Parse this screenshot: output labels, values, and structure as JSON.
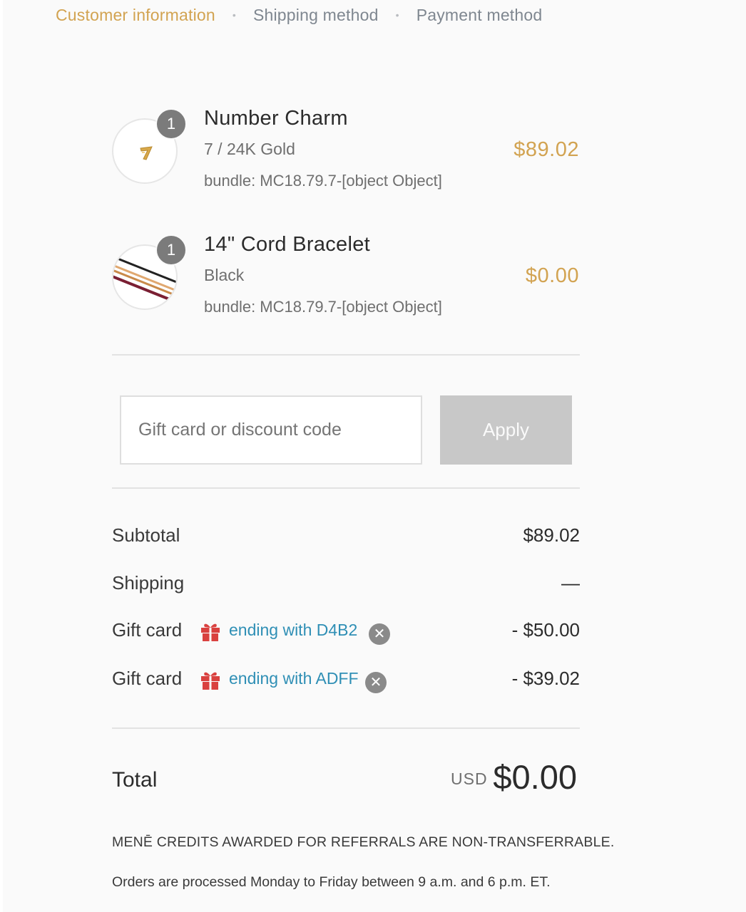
{
  "breadcrumbs": {
    "customer": "Customer information",
    "shipping": "Shipping method",
    "payment": "Payment method",
    "separator": "•"
  },
  "items": [
    {
      "quantity": "1",
      "name": "Number Charm",
      "variant": "7 / 24K Gold",
      "bundle": "bundle: MC18.79.7-[object Object]",
      "price": "$89.02",
      "image_icon": "gold-number-7-charm"
    },
    {
      "quantity": "1",
      "name": "14\" Cord Bracelet",
      "variant": "Black",
      "bundle": "bundle: MC18.79.7-[object Object]",
      "price": "$0.00",
      "image_icon": "cord-bracelet-strands"
    }
  ],
  "discount": {
    "placeholder": "Gift card or discount code",
    "apply_label": "Apply"
  },
  "summary": {
    "subtotal_label": "Subtotal",
    "subtotal_value": "$89.02",
    "shipping_label": "Shipping",
    "shipping_value": "—",
    "gift_cards": [
      {
        "label": "Gift card",
        "text": "ending with D4B2",
        "value": "- $50.00"
      },
      {
        "label": "Gift card",
        "text": "ending with ADFF",
        "value": "- $39.02"
      }
    ],
    "total_label": "Total",
    "currency": "USD",
    "total_value": "$0.00"
  },
  "notes": {
    "credits": "MENĒ CREDITS AWARDED FOR REFERRALS ARE NON-TRANSFERRABLE.",
    "processing": "Orders are processed Monday to Friday between 9 a.m. and 6 p.m. ET."
  },
  "colors": {
    "accent_gold": "#d2a351",
    "link_blue": "#2f8fb5",
    "gift_red": "#d9413f",
    "badge_gray": "#7b7b7b"
  }
}
